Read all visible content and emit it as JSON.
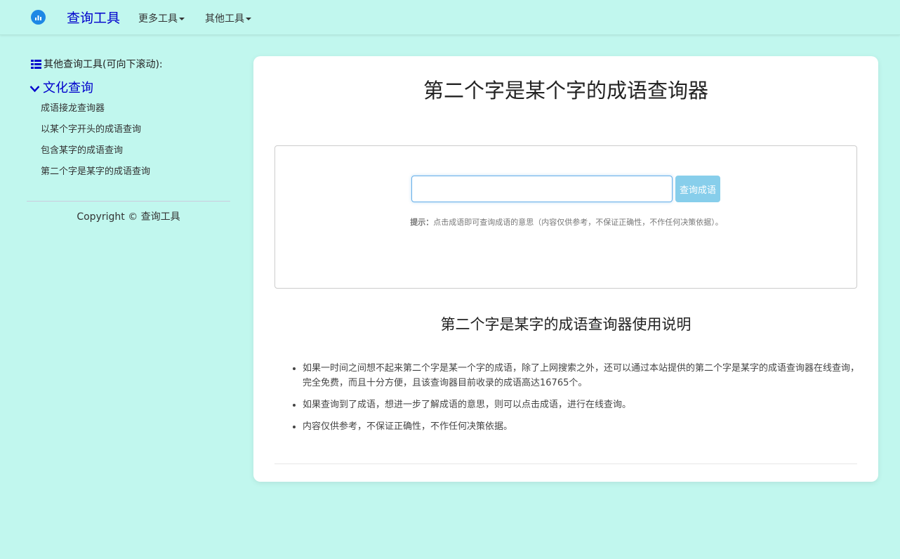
{
  "navbar": {
    "brand": "查询工具",
    "menus": [
      "更多工具",
      "其他工具"
    ]
  },
  "sidebar": {
    "heading": "其他查询工具(可向下滚动):",
    "category": "文化查询",
    "links": [
      "成语接龙查询器",
      "以某个字开头的成语查询",
      "包含某字的成语查询",
      "第二个字是某字的成语查询"
    ],
    "copyright": "Copyright © 查询工具"
  },
  "main": {
    "title": "第二个字是某个字的成语查询器",
    "search": {
      "value": "",
      "button_label": "查询成语"
    },
    "hint_label": "提示：",
    "hint_text": "点击成语即可查询成语的意思（内容仅供参考，不保证正确性，不作任何决策依据）。",
    "instructions_title": "第二个字是某字的成语查询器使用说明",
    "instructions": [
      "如果一时间之间想不起来第二个字是某一个字的成语，除了上网搜索之外，还可以通过本站提供的第二个字是某字的成语查询器在线查询，完全免费，而且十分方便，且该查询器目前收录的成语高达16765个。",
      "如果查询到了成语，想进一步了解成语的意思，则可以点击成语，进行在线查询。",
      "内容仅供参考，不保证正确性，不作任何决策依据。"
    ]
  },
  "colors": {
    "background": "#c1f7ee",
    "brand": "#0000cc",
    "button": "#87ceeb"
  },
  "icons": [
    "logo-icon",
    "caret-down-icon",
    "list-icon",
    "chevron-down-icon"
  ]
}
